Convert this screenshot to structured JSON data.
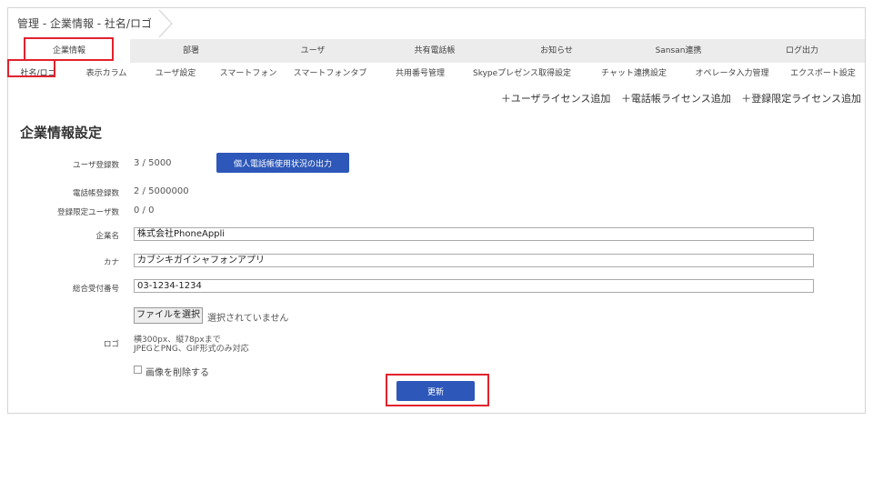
{
  "breadcrumb": "管理 - 企業情報 - 社名/ロゴ",
  "tabs": [
    {
      "label": "企業情報",
      "active": true
    },
    {
      "label": "部署"
    },
    {
      "label": "ユーザ"
    },
    {
      "label": "共有電話帳"
    },
    {
      "label": "お知らせ"
    },
    {
      "label": "Sansan連携"
    },
    {
      "label": "ログ出力"
    }
  ],
  "subtabs": [
    {
      "label": "社名/ロゴ",
      "active": true
    },
    {
      "label": "表示カラム"
    },
    {
      "label": "ユーザ設定"
    },
    {
      "label": "スマートフォン"
    },
    {
      "label": "スマートフォンタブ"
    },
    {
      "label": "共用番号管理"
    },
    {
      "label": "Skypeプレゼンス取得設定"
    },
    {
      "label": "チャット連携設定"
    },
    {
      "label": "オペレータ入力管理"
    },
    {
      "label": "エクスポート設定"
    }
  ],
  "license_links": {
    "user": "＋ユーザライセンス追加",
    "phonebook": "＋電話帳ライセンス追加",
    "limited": "＋登録限定ライセンス追加"
  },
  "section_title": "企業情報設定",
  "fields": {
    "user_count_label": "ユーザ登録数",
    "user_count_value": "3 / 5000",
    "export_button": "個人電話帳使用状況の出力",
    "phonebook_count_label": "電話帳登録数",
    "phonebook_count_value": "2 / 5000000",
    "limited_user_label": "登録限定ユーザ数",
    "limited_user_value": "0 / 0",
    "company_name_label": "企業名",
    "company_name_value": "株式会社PhoneAppli",
    "kana_label": "カナ",
    "kana_value": "カブシキガイシャフォンアプリ",
    "reception_label": "総合受付番号",
    "reception_value": "03-1234-1234",
    "logo_label": "ロゴ",
    "file_button": "ファイルを選択",
    "file_none": "選択されていません",
    "logo_note_1": "横300px、縦78pxまで",
    "logo_note_2": "JPEGとPNG、GIF形式のみ対応",
    "delete_image_label": "画像を削除する",
    "update_button": "更新"
  },
  "colors": {
    "accent": "#2d57b8",
    "highlight": "#e2222d"
  }
}
